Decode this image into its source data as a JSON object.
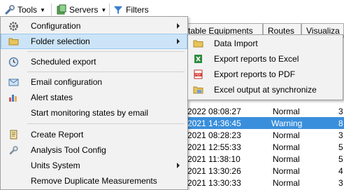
{
  "toolbar": {
    "tools_label": "Tools",
    "servers_label": "Servers",
    "filters_label": "Filters"
  },
  "tabs": [
    {
      "label": "table Equipments"
    },
    {
      "label": "Routes"
    },
    {
      "label": "Visualiza"
    }
  ],
  "table": {
    "rows": [
      {
        "date": "2022 08:08:27",
        "status": "Normal",
        "num": "3",
        "selected": false
      },
      {
        "date": "2021 14:36:45",
        "status": "Warning",
        "num": "8",
        "selected": true
      },
      {
        "date": "2021 08:28:23",
        "status": "Normal",
        "num": "3",
        "selected": false
      },
      {
        "date": "2021 12:55:33",
        "status": "Normal",
        "num": "5",
        "selected": false
      },
      {
        "date": "2021 11:38:10",
        "status": "Normal",
        "num": "5",
        "selected": false
      },
      {
        "date": "2021 13:30:26",
        "status": "Normal",
        "num": "4",
        "selected": false
      },
      {
        "date": "2021 13:30:33",
        "status": "Normal",
        "num": "3",
        "selected": false
      }
    ]
  },
  "menu": {
    "items": [
      {
        "label": "Configuration",
        "icon": "gear-icon",
        "submenu": true
      },
      {
        "label": "Folder selection",
        "icon": "folder-icon",
        "submenu": true,
        "highlighted": true
      },
      {
        "label": "Scheduled export",
        "icon": "clock-icon",
        "submenu": false
      },
      {
        "label": "Email configuration",
        "icon": "envelope-icon",
        "submenu": false
      },
      {
        "label": "Alert states",
        "icon": "bar-chart-icon",
        "submenu": false
      },
      {
        "label": "Start monitoring states by email",
        "icon": "",
        "submenu": false
      },
      {
        "label": "Create Report",
        "icon": "report-icon",
        "submenu": false
      },
      {
        "label": "Analysis Tool Config",
        "icon": "wrench-icon",
        "submenu": false
      },
      {
        "label": "Units System",
        "icon": "",
        "submenu": true
      },
      {
        "label": "Remove Duplicate Measurements",
        "icon": "",
        "submenu": false
      }
    ]
  },
  "submenu": {
    "items": [
      {
        "label": "Data Import",
        "icon": "folder-icon"
      },
      {
        "label": "Export reports to Excel",
        "icon": "excel-icon"
      },
      {
        "label": "Export reports to PDF",
        "icon": "pdf-icon"
      },
      {
        "label": "Excel output at synchronize",
        "icon": "folder-icon"
      }
    ]
  },
  "colors": {
    "menu_bg": "#f2f2f2",
    "highlight": "#cce4f7",
    "selected_row": "#3a8fdc"
  }
}
